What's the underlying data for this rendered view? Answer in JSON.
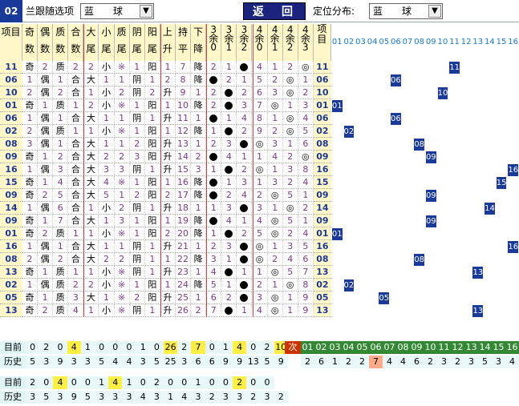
{
  "top": {
    "id": "02",
    "label1": "兰跟随选项",
    "sel1": "蓝　　球",
    "back": "返　回",
    "label2": "定位分布:",
    "sel2": "蓝　　球"
  },
  "headers": [
    "项目",
    "奇数",
    "偶数",
    "质数",
    "合数",
    "大尾",
    "小尾",
    "质尾",
    "阴尾",
    "阳尾",
    "上升",
    "持平",
    "下降",
    "3余0",
    "3余1",
    "3余2",
    "4余0",
    "4余1",
    "4余2",
    "4余3",
    "项目"
  ],
  "nums": [
    "01",
    "02",
    "03",
    "04",
    "05",
    "06",
    "07",
    "08",
    "09",
    "10",
    "11",
    "12",
    "13",
    "14",
    "15",
    "16"
  ],
  "rows": [
    [
      "11",
      "奇",
      "2",
      "质",
      "2",
      "2",
      "小",
      "※",
      "1",
      "阳",
      "1",
      "7",
      "降",
      "2",
      "1",
      "●",
      "4",
      "1",
      "2",
      "◎"
    ],
    [
      "06",
      "1",
      "偶",
      "1",
      "合",
      "大",
      "1",
      "1",
      "阴",
      "1",
      "2",
      "8",
      "降",
      "●",
      "2",
      "1",
      "5",
      "2",
      "◎",
      "1"
    ],
    [
      "10",
      "2",
      "偶",
      "2",
      "合",
      "1",
      "小",
      "2",
      "阴",
      "2",
      "升",
      "9",
      "1",
      "2",
      "●",
      "2",
      "6",
      "3",
      "◎",
      "2"
    ],
    [
      "01",
      "奇",
      "1",
      "质",
      "1",
      "2",
      "小",
      "※",
      "1",
      "阳",
      "1",
      "10",
      "降",
      "2",
      "●",
      "3",
      "7",
      "◎",
      "1",
      "3"
    ],
    [
      "06",
      "1",
      "偶",
      "1",
      "合",
      "大",
      "1",
      "1",
      "阴",
      "1",
      "升",
      "11",
      "1",
      "●",
      "1",
      "4",
      "8",
      "1",
      "◎",
      "4"
    ],
    [
      "02",
      "2",
      "偶",
      "质",
      "1",
      "1",
      "小",
      "※",
      "1",
      "阳",
      "1",
      "12",
      "降",
      "1",
      "●",
      "2",
      "9",
      "2",
      "◎",
      "5"
    ],
    [
      "08",
      "3",
      "偶",
      "1",
      "合",
      "大",
      "1",
      "1",
      "2",
      "阳",
      "升",
      "13",
      "1",
      "2",
      "3",
      "●",
      "◎",
      "3",
      "1",
      "6"
    ],
    [
      "09",
      "奇",
      "1",
      "2",
      "合",
      "大",
      "2",
      "2",
      "3",
      "阳",
      "升",
      "14",
      "2",
      "●",
      "4",
      "1",
      "1",
      "4",
      "2",
      "◎"
    ],
    [
      "16",
      "1",
      "偶",
      "3",
      "合",
      "大",
      "3",
      "3",
      "阴",
      "1",
      "升",
      "15",
      "3",
      "1",
      "●",
      "2",
      "◎",
      "1",
      "3",
      "8"
    ],
    [
      "15",
      "奇",
      "1",
      "4",
      "合",
      "大",
      "4",
      "※",
      "1",
      "阳",
      "1",
      "16",
      "降",
      "●",
      "1",
      "3",
      "1",
      "3",
      "2",
      "4"
    ],
    [
      "09",
      "奇",
      "2",
      "5",
      "合",
      "大",
      "5",
      "1",
      "2",
      "阳",
      "2",
      "17",
      "降",
      "●",
      "2",
      "4",
      "2",
      "◎",
      "5",
      "1"
    ],
    [
      "14",
      "1",
      "偶",
      "6",
      "合",
      "1",
      "小",
      "2",
      "阴",
      "1",
      "升",
      "18",
      "1",
      "1",
      "3",
      "●",
      "3",
      "1",
      "◎",
      "2"
    ],
    [
      "09",
      "奇",
      "1",
      "7",
      "合",
      "大",
      "1",
      "3",
      "1",
      "阳",
      "1",
      "19",
      "降",
      "●",
      "4",
      "1",
      "4",
      "◎",
      "5",
      "1"
    ],
    [
      "01",
      "奇",
      "2",
      "质",
      "1",
      "1",
      "小",
      "※",
      "1",
      "阳",
      "2",
      "20",
      "降",
      "1",
      "●",
      "2",
      "5",
      "◎",
      "2",
      "4"
    ],
    [
      "16",
      "1",
      "偶",
      "1",
      "合",
      "大",
      "1",
      "1",
      "阴",
      "1",
      "升",
      "21",
      "1",
      "2",
      "3",
      "●",
      "◎",
      "1",
      "3",
      "5"
    ],
    [
      "08",
      "2",
      "偶",
      "2",
      "合",
      "大",
      "2",
      "2",
      "阴",
      "1",
      "1",
      "22",
      "降",
      "3",
      "1",
      "●",
      "◎",
      "2",
      "4",
      "6"
    ],
    [
      "13",
      "奇",
      "1",
      "质",
      "1",
      "1",
      "小",
      "※",
      "阴",
      "1",
      "升",
      "23",
      "1",
      "4",
      "●",
      "1",
      "1",
      "◎",
      "5",
      "7"
    ],
    [
      "02",
      "1",
      "偶",
      "质",
      "2",
      "2",
      "小",
      "※",
      "1",
      "阳",
      "1",
      "24",
      "降",
      "5",
      "1",
      "●",
      "2",
      "1",
      "◎",
      "8"
    ],
    [
      "05",
      "奇",
      "1",
      "质",
      "3",
      "大",
      "1",
      "※",
      "2",
      "阳",
      "升",
      "25",
      "1",
      "6",
      "2",
      "●",
      "3",
      "◎",
      "1",
      "9"
    ],
    [
      "13",
      "奇",
      "2",
      "质",
      "4",
      "1",
      "小",
      "※",
      "阴",
      "1",
      "升",
      "26",
      "2",
      "7",
      "●",
      "1",
      "4",
      "◎",
      "1",
      "9"
    ]
  ],
  "bottom": {
    "cur_label": "目前",
    "hist_label": "历史",
    "cur": [
      "0",
      "2",
      "0",
      "4",
      "1",
      "0",
      "0",
      "0",
      "1",
      "0",
      "26",
      "2",
      "7",
      "0",
      "1",
      "4",
      "0",
      "2",
      "10"
    ],
    "hist": [
      "5",
      "3",
      "9",
      "3",
      "3",
      "5",
      "4",
      "4",
      "3",
      "5",
      "25",
      "3",
      "6",
      "6",
      "9",
      "9",
      "13",
      "5",
      "9"
    ],
    "next_label": "次数",
    "next_nums": [
      "01",
      "02",
      "03",
      "04",
      "05",
      "06",
      "07",
      "08",
      "09",
      "10",
      "11",
      "12",
      "13",
      "14",
      "15",
      "16"
    ],
    "next_counts": [
      "2",
      "6",
      "1",
      "2",
      "2",
      "7",
      "4",
      "4",
      "6",
      "2",
      "3",
      "2",
      "3",
      "5",
      "3",
      "4"
    ],
    "cur2": [
      "2",
      "0",
      "4",
      "0",
      "0",
      "1",
      "4",
      "1",
      "0",
      "2",
      "0",
      "0",
      "1",
      "0",
      "0",
      "2",
      "0",
      "0"
    ],
    "hist2": [
      "3",
      "5",
      "3",
      "9",
      "5",
      "3",
      "3",
      "3",
      "4",
      "3",
      "1",
      "4",
      "3",
      "2",
      "3",
      "3",
      "2",
      "3",
      "2"
    ]
  }
}
